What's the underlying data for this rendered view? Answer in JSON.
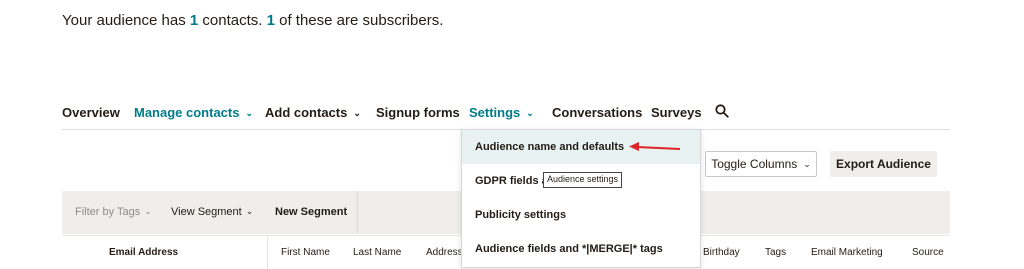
{
  "summary": {
    "part1": "Your audience has ",
    "count1": "1",
    "part2": " contacts. ",
    "count2": "1",
    "part3": " of these are subscribers."
  },
  "nav": {
    "overview": "Overview",
    "manage_contacts": "Manage contacts",
    "add_contacts": "Add contacts",
    "signup_forms": "Signup forms",
    "settings": "Settings",
    "conversations": "Conversations",
    "surveys": "Surveys",
    "search_icon": "search-icon",
    "chevron_icon": "chevron-down-icon"
  },
  "settings_menu": {
    "items": [
      "Audience name and defaults",
      "GDPR fields and",
      "Publicity settings",
      "Audience fields and *|MERGE|* tags"
    ],
    "tooltip": "Audience settings"
  },
  "toolbar": {
    "toggle_columns": "Toggle Columns",
    "export_audience": "Export Audience"
  },
  "filters": {
    "filter_by_tags": "Filter by Tags",
    "view_segment": "View Segment",
    "new_segment": "New Segment"
  },
  "table": {
    "columns": [
      "Email Address",
      "First Name",
      "Last Name",
      "Address",
      "Birthday",
      "Tags",
      "Email Marketing",
      "Source"
    ]
  },
  "colors": {
    "accent": "#007c89",
    "highlight_border": "#e0252a",
    "filter_bar": "#efeeea"
  }
}
